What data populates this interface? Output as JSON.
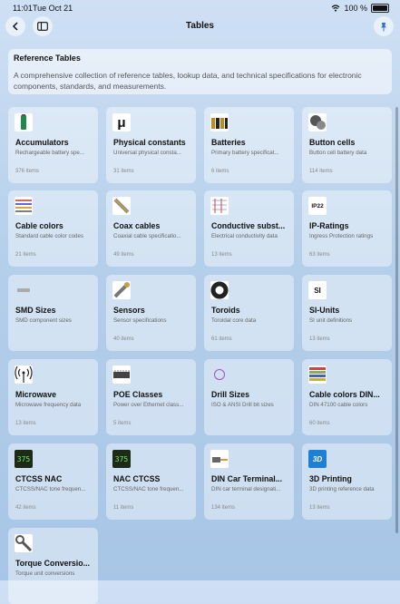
{
  "status": {
    "time": "11:01",
    "date": "Tue Oct 21",
    "battery": "100 %"
  },
  "nav": {
    "title": "Tables"
  },
  "header": {
    "heading": "Reference Tables",
    "description": "A comprehensive collection of reference tables, lookup data, and technical specifications for electronic components, standards, and measurements."
  },
  "items": [
    {
      "title": "Accumulators",
      "subtitle": "Rechargeable battery spe...",
      "count": "376 items",
      "icon": "accumulator-icon"
    },
    {
      "title": "Physical constants",
      "subtitle": "Universal physical consta...",
      "count": "31 items",
      "icon": "mu-icon"
    },
    {
      "title": "Batteries",
      "subtitle": "Primary battery specificat...",
      "count": "6 items",
      "icon": "batteries-icon"
    },
    {
      "title": "Button cells",
      "subtitle": "Button cell battery data",
      "count": "114 items",
      "icon": "button-cell-icon"
    },
    {
      "title": "Cable colors",
      "subtitle": "Standard cable color codes",
      "count": "21 items",
      "icon": "cable-colors-icon"
    },
    {
      "title": "Coax cables",
      "subtitle": "Coaxial cable specificatio...",
      "count": "49 items",
      "icon": "coax-icon"
    },
    {
      "title": "Conductive subst...",
      "subtitle": "Electrical conductivity data",
      "count": "13 items",
      "icon": "conductive-icon"
    },
    {
      "title": "IP-Ratings",
      "subtitle": "Ingress Protection ratings",
      "count": "63 items",
      "icon": "ip22-icon"
    },
    {
      "title": "SMD Sizes",
      "subtitle": "SMD component sizes",
      "count": "",
      "icon": "smd-icon"
    },
    {
      "title": "Sensors",
      "subtitle": "Sensor specifications",
      "count": "40 items",
      "icon": "sensor-icon"
    },
    {
      "title": "Toroids",
      "subtitle": "Toroidal core data",
      "count": "61 items",
      "icon": "toroid-icon"
    },
    {
      "title": "SI-Units",
      "subtitle": "SI unit definitions",
      "count": "13 items",
      "icon": "si-icon"
    },
    {
      "title": "Microwave",
      "subtitle": "Microwave frequency data",
      "count": "13 items",
      "icon": "antenna-icon"
    },
    {
      "title": "POE Classes",
      "subtitle": "Power over Ethernet class...",
      "count": "5 items",
      "icon": "poe-icon"
    },
    {
      "title": "Drill Sizes",
      "subtitle": "ISO & ANSI Drill bit sizes",
      "count": "",
      "icon": "drill-icon"
    },
    {
      "title": "Cable colors DIN...",
      "subtitle": "DIN 47100 cable colors",
      "count": "60 items",
      "icon": "din-cable-icon"
    },
    {
      "title": "CTCSS NAC",
      "subtitle": "CTCSS/NAC tone frequen...",
      "count": "42 items",
      "icon": "ctcss-display-icon"
    },
    {
      "title": "NAC CTCSS",
      "subtitle": "CTCSS/NAC tone frequen...",
      "count": "11 items",
      "icon": "nac-display-icon"
    },
    {
      "title": "DIN Car Terminal...",
      "subtitle": "DIN car terminal designati...",
      "count": "134 items",
      "icon": "terminal-icon"
    },
    {
      "title": "3D Printing",
      "subtitle": "3D printing reference data",
      "count": "13 items",
      "icon": "3d-icon"
    },
    {
      "title": "Torque Conversio...",
      "subtitle": "Torque unit conversions",
      "count": "",
      "icon": "torque-icon"
    }
  ],
  "icon_text": {
    "mu": "μ",
    "ip": "IP22",
    "si": "SI",
    "display": "375",
    "three_d": "3D"
  }
}
